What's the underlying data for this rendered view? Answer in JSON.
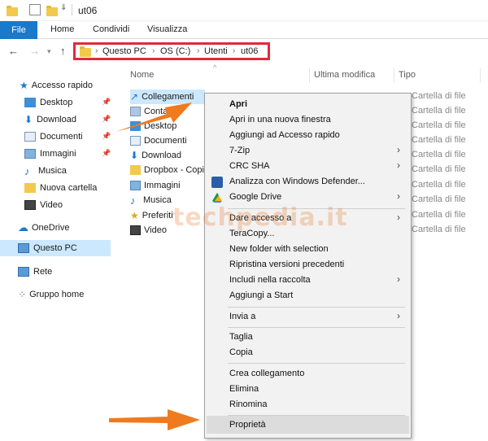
{
  "window": {
    "title": "ut06"
  },
  "ribbon": {
    "tabs": [
      {
        "label": "File"
      },
      {
        "label": "Home"
      },
      {
        "label": "Condividi"
      },
      {
        "label": "Visualizza"
      }
    ]
  },
  "address_bar": {
    "crumbs": [
      "Questo PC",
      "OS (C:)",
      "Utenti",
      "ut06"
    ],
    "highlight_color": "#e02a3a"
  },
  "sidebar": {
    "quick_access": "Accesso rapido",
    "items": [
      {
        "label": "Desktop",
        "pinned": true,
        "icon": "desktop-icon"
      },
      {
        "label": "Download",
        "pinned": true,
        "icon": "download-icon"
      },
      {
        "label": "Documenti",
        "pinned": true,
        "icon": "documents-icon"
      },
      {
        "label": "Immagini",
        "pinned": true,
        "icon": "pictures-icon"
      },
      {
        "label": "Musica",
        "pinned": false,
        "icon": "music-icon"
      },
      {
        "label": "Nuova cartella",
        "pinned": false,
        "icon": "folder-icon"
      },
      {
        "label": "Video",
        "pinned": false,
        "icon": "video-icon"
      }
    ],
    "onedrive": "OneDrive",
    "this_pc": "Questo PC",
    "network": "Rete",
    "homegroup": "Gruppo home"
  },
  "columns": {
    "name": "Nome",
    "modified": "Ultima modifica",
    "type": "Tipo"
  },
  "files": [
    {
      "name": "Collegamenti",
      "type": "Cartella di file",
      "selected": true
    },
    {
      "name": "Contatti",
      "type": "Cartella di file"
    },
    {
      "name": "Desktop",
      "type": "Cartella di file"
    },
    {
      "name": "Documenti",
      "type": "Cartella di file"
    },
    {
      "name": "Download",
      "type": "Cartella di file"
    },
    {
      "name": "Dropbox - Copia",
      "type": "Cartella di file"
    },
    {
      "name": "Immagini",
      "type": "Cartella di file"
    },
    {
      "name": "Musica",
      "type": "Cartella di file"
    },
    {
      "name": "Preferiti",
      "type": "Cartella di file"
    },
    {
      "name": "Video",
      "type": "Cartella di file"
    }
  ],
  "context_menu": {
    "items": [
      "Apri",
      "Apri in una nuova finestra",
      "Aggiungi ad Accesso rapido",
      "7-Zip",
      "CRC SHA",
      "Analizza con Windows Defender...",
      "Google Drive",
      "Dare accesso a",
      "TeraCopy...",
      "New folder with selection",
      "Ripristina versioni precedenti",
      "Includi nella raccolta",
      "Aggiungi a Start",
      "Invia a",
      "Taglia",
      "Copia",
      "Crea collegamento",
      "Elimina",
      "Rinomina",
      "Proprietà"
    ],
    "highlighted": "Proprietà"
  },
  "watermark": "techpedia.it",
  "colors": {
    "accent": "#1979ca",
    "selection": "#cce8ff",
    "arrow": "#f07a1e",
    "menu_bg": "#f2f2f2"
  }
}
